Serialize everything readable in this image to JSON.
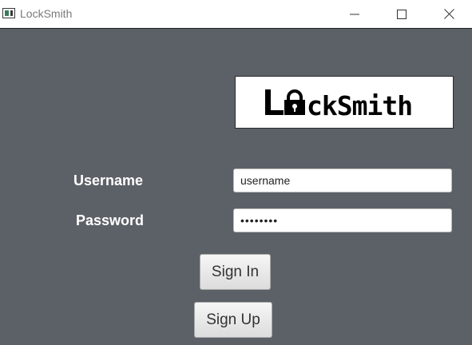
{
  "window": {
    "title": "LockSmith",
    "icon": "app-window-icon",
    "controls": [
      "minimize-icon",
      "maximize-icon",
      "close-icon"
    ]
  },
  "logo": {
    "text": "LockSmith",
    "icon": "padlock-icon"
  },
  "form": {
    "username_label": "Username",
    "username_value": "username",
    "password_label": "Password",
    "password_value": "••••••••"
  },
  "buttons": {
    "sign_in": "Sign In",
    "sign_up": "Sign Up"
  },
  "colors": {
    "background": "#5c6168",
    "label_text": "#ffffff"
  }
}
